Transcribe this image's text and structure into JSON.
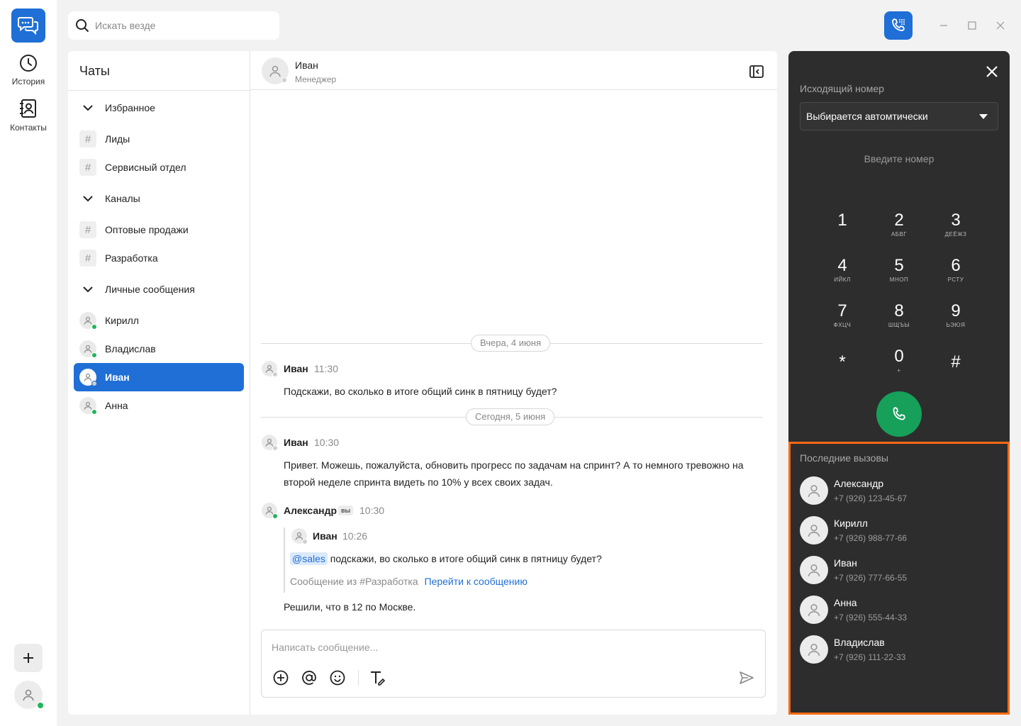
{
  "rail": {
    "history_label": "История",
    "contacts_label": "Контакты"
  },
  "search": {
    "placeholder": "Искать везде"
  },
  "chatlist": {
    "title": "Чаты",
    "sections": {
      "favorites": "Избранное",
      "channels": "Каналы",
      "direct": "Личные сообщения"
    },
    "favorites": [
      "Лиды",
      "Сервисный отдел"
    ],
    "channels": [
      "Оптовые продажи",
      "Разработка"
    ],
    "direct": [
      {
        "name": "Кирилл",
        "online": true
      },
      {
        "name": "Владислав",
        "online": true
      },
      {
        "name": "Иван",
        "online": false,
        "active": true
      },
      {
        "name": "Анна",
        "online": true
      }
    ]
  },
  "conversation": {
    "name": "Иван",
    "role": "Менеджер",
    "date1": "Вчера, 4 июня",
    "date2": "Сегодня, 5 июня",
    "messages": [
      {
        "author": "Иван",
        "time": "11:30",
        "text": "Подскажи, во сколько в итоге общий синк в пятницу будет?"
      },
      {
        "author": "Иван",
        "time": "10:30",
        "text": "Привет. Можешь, пожалуйста, обновить прогресс по задачам на спринт? А то немного тревожно на второй неделе спринта видеть по 10% у всех своих задач."
      },
      {
        "author": "Александр",
        "badge": "вы",
        "time": "10:30",
        "quote": {
          "author": "Иван",
          "time": "10:26",
          "mention": "@sales",
          "text": "подскажи, во сколько в итоге общий синк в пятницу будет?",
          "source": "Сообщение из #Разработка",
          "link": "Перейти к сообщению"
        },
        "text": "Решили, что в 12 по Москве."
      }
    ],
    "composer_placeholder": "Написать сообщение..."
  },
  "dialer": {
    "outgoing_label": "Исходящий номер",
    "outgoing_value": "Выбирается автомтически",
    "input_placeholder": "Введите номер",
    "keys": [
      {
        "d": "1",
        "s": ""
      },
      {
        "d": "2",
        "s": "АБВГ"
      },
      {
        "d": "3",
        "s": "ДЕЁЖЗ"
      },
      {
        "d": "4",
        "s": "ИЙКЛ"
      },
      {
        "d": "5",
        "s": "МНОП"
      },
      {
        "d": "6",
        "s": "РСТУ"
      },
      {
        "d": "7",
        "s": "ФХЦЧ"
      },
      {
        "d": "8",
        "s": "ШЩЪЫ"
      },
      {
        "d": "9",
        "s": "ЬЭЮЯ"
      },
      {
        "d": "*",
        "s": ""
      },
      {
        "d": "0",
        "s": "+"
      },
      {
        "d": "#",
        "s": ""
      }
    ],
    "recent_title": "Последние вызовы",
    "recent": [
      {
        "name": "Александр",
        "phone": "+7 (926) 123-45-67"
      },
      {
        "name": "Кирилл",
        "phone": "+7 (926) 988-77-66"
      },
      {
        "name": "Иван",
        "phone": "+7 (926) 777-66-55"
      },
      {
        "name": "Анна",
        "phone": "+7 (926) 555-44-33"
      },
      {
        "name": "Владислав",
        "phone": "+7 (926) 111-22-33"
      }
    ]
  },
  "colors": {
    "accent": "#1f6fd6",
    "call": "#16a05a",
    "highlight": "#ff6a13",
    "online": "#21b55a"
  }
}
